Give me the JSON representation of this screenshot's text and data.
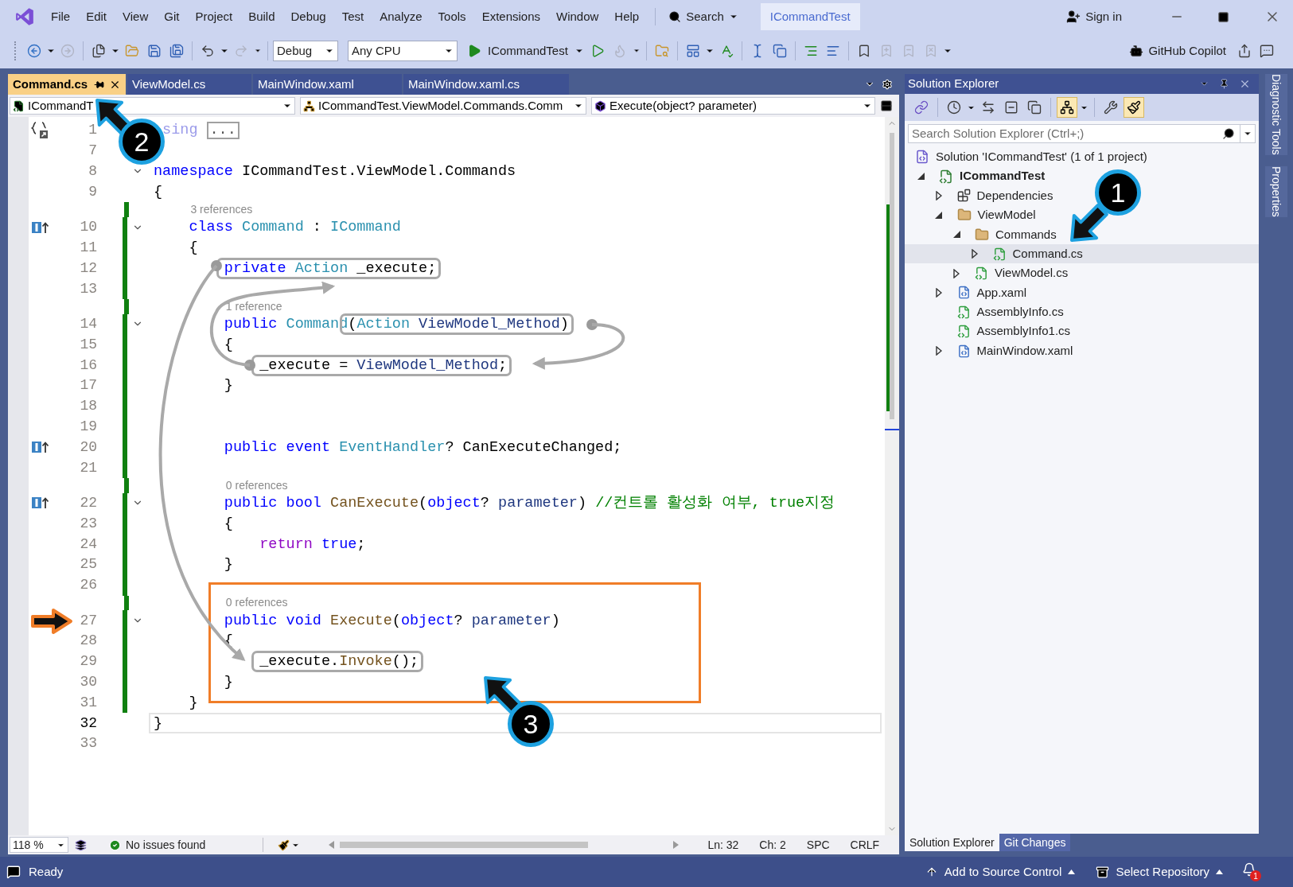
{
  "title_bar": {
    "menu": [
      "File",
      "Edit",
      "View",
      "Git",
      "Project",
      "Build",
      "Debug",
      "Test",
      "Analyze",
      "Tools",
      "Extensions",
      "Window",
      "Help"
    ],
    "search": "Search",
    "solution_name": "ICommandTest",
    "sign_in": "Sign in"
  },
  "toolbar": {
    "configuration": "Debug",
    "platform": "Any CPU",
    "startup_project": "ICommandTest",
    "copilot": "GitHub Copilot"
  },
  "document_tabs": [
    {
      "label": "Command.cs",
      "selected": true
    },
    {
      "label": "ViewModel.cs",
      "selected": false
    },
    {
      "label": "MainWindow.xaml",
      "selected": false
    },
    {
      "label": "MainWindow.xaml.cs",
      "selected": false
    }
  ],
  "navigation_bar": {
    "project": "ICommandT",
    "type": "ICommandTest.ViewModel.Commands.Comm",
    "member": "Execute(object? parameter)"
  },
  "editor": {
    "lines": [
      {
        "kind": "code",
        "n": "1",
        "margin": {
          "kind": "region"
        },
        "fold": false,
        "changed": false,
        "current": false,
        "tokens": [
          {
            "t": " sing",
            "kind": "faded"
          },
          {
            "t": "...",
            "kind": "collapsed"
          }
        ]
      },
      {
        "kind": "code",
        "n": "7",
        "fold": false,
        "changed": false,
        "current": false
      },
      {
        "kind": "code",
        "n": "8",
        "fold": true,
        "changed": false,
        "current": false,
        "tokens": [
          {
            "t": "namespace",
            "kind": "kw"
          },
          {
            "t": " ICommandTest.ViewModel.Commands",
            "kind": "plain"
          }
        ]
      },
      {
        "kind": "code",
        "n": "9",
        "fold": false,
        "changed": false,
        "current": false,
        "tokens": [
          {
            "t": "{",
            "kind": "plain"
          }
        ]
      },
      {
        "kind": "codelens",
        "text": "3 references",
        "changed": true
      },
      {
        "kind": "code",
        "n": "10",
        "margin": {
          "kind": "implements"
        },
        "fold": true,
        "changed": true,
        "current": false,
        "tokens": [
          {
            "t": "    class",
            "kind": "kw"
          },
          {
            "t": " Command",
            "kind": "type"
          },
          {
            "t": " : ",
            "kind": "plain"
          },
          {
            "t": "ICommand",
            "kind": "type"
          }
        ]
      },
      {
        "kind": "code",
        "n": "11",
        "fold": false,
        "changed": true,
        "current": false,
        "tokens": [
          {
            "t": "    {",
            "kind": "plain"
          }
        ]
      },
      {
        "kind": "code",
        "n": "12",
        "fold": false,
        "changed": true,
        "current": false,
        "tokens": [
          {
            "kind": "box",
            "parts": [
              {
                "t": "        private",
                "kind": "kw"
              },
              {
                "t": " Action",
                "kind": "type"
              },
              {
                "t": " _execute;",
                "kind": "plain"
              }
            ]
          }
        ]
      },
      {
        "kind": "code",
        "n": "13",
        "fold": false,
        "changed": true,
        "current": false
      },
      {
        "kind": "codelens",
        "text": "1 reference",
        "changed": true
      },
      {
        "kind": "code",
        "n": "14",
        "fold": true,
        "changed": true,
        "current": false,
        "tokens": [
          {
            "t": "        public",
            "kind": "kw"
          },
          {
            "t": " Command",
            "kind": "type"
          },
          {
            "kind": "box",
            "parts": [
              {
                "t": "(",
                "kind": "plain"
              },
              {
                "t": "Action",
                "kind": "type"
              },
              {
                "t": " ViewModel_Method",
                "kind": "param"
              },
              {
                "t": ")",
                "kind": "plain"
              }
            ]
          }
        ]
      },
      {
        "kind": "code",
        "n": "15",
        "fold": false,
        "changed": true,
        "current": false,
        "tokens": [
          {
            "t": "        {",
            "kind": "plain"
          }
        ]
      },
      {
        "kind": "code",
        "n": "16",
        "fold": false,
        "changed": true,
        "current": false,
        "tokens": [
          {
            "kind": "box",
            "parts": [
              {
                "t": "            _execute = ",
                "kind": "plain"
              },
              {
                "t": "ViewModel_Method",
                "kind": "param"
              },
              {
                "t": ";",
                "kind": "plain"
              }
            ]
          }
        ]
      },
      {
        "kind": "code",
        "n": "17",
        "fold": false,
        "changed": true,
        "current": false,
        "tokens": [
          {
            "t": "        }",
            "kind": "plain"
          }
        ]
      },
      {
        "kind": "code",
        "n": "18",
        "fold": false,
        "changed": true,
        "current": false
      },
      {
        "kind": "code",
        "n": "19",
        "fold": false,
        "changed": true,
        "current": false
      },
      {
        "kind": "code",
        "n": "20",
        "margin": {
          "kind": "implements"
        },
        "fold": false,
        "changed": true,
        "current": false,
        "tokens": [
          {
            "t": "        public",
            "kind": "kw"
          },
          {
            "t": " event",
            "kind": "kw"
          },
          {
            "t": " EventHandler",
            "kind": "type"
          },
          {
            "t": "? CanExecuteChanged;",
            "kind": "plain"
          }
        ]
      },
      {
        "kind": "code",
        "n": "21",
        "fold": false,
        "changed": true,
        "current": false
      },
      {
        "kind": "codelens",
        "text": "0 references",
        "changed": true
      },
      {
        "kind": "code",
        "n": "22",
        "margin": {
          "kind": "implements"
        },
        "fold": true,
        "changed": true,
        "current": false,
        "tokens": [
          {
            "t": "        public",
            "kind": "kw"
          },
          {
            "t": " bool",
            "kind": "kw"
          },
          {
            "t": " CanExecute",
            "kind": "method"
          },
          {
            "t": "(",
            "kind": "plain"
          },
          {
            "t": "object",
            "kind": "kw"
          },
          {
            "t": "? ",
            "kind": "plain"
          },
          {
            "t": "parameter",
            "kind": "param"
          },
          {
            "t": ") ",
            "kind": "plain"
          },
          {
            "t": "//컨트롤 활성화 여부, true지정",
            "kind": "comment"
          }
        ]
      },
      {
        "kind": "code",
        "n": "23",
        "fold": false,
        "changed": true,
        "current": false,
        "tokens": [
          {
            "t": "        {",
            "kind": "plain"
          }
        ]
      },
      {
        "kind": "code",
        "n": "24",
        "fold": false,
        "changed": true,
        "current": false,
        "tokens": [
          {
            "t": "            return",
            "kind": "ctrl"
          },
          {
            "t": " true",
            "kind": "kw"
          },
          {
            "t": ";",
            "kind": "plain"
          }
        ]
      },
      {
        "kind": "code",
        "n": "25",
        "fold": false,
        "changed": true,
        "current": false,
        "tokens": [
          {
            "t": "        }",
            "kind": "plain"
          }
        ]
      },
      {
        "kind": "code",
        "n": "26",
        "fold": false,
        "changed": true,
        "current": false
      },
      {
        "kind": "codelens",
        "text": "0 references",
        "changed": true
      },
      {
        "kind": "code",
        "n": "27",
        "fold": true,
        "changed": true,
        "current": false,
        "tokens": [
          {
            "t": "        public",
            "kind": "kw"
          },
          {
            "t": " void",
            "kind": "kw"
          },
          {
            "t": " Execute",
            "kind": "method"
          },
          {
            "t": "(",
            "kind": "plain"
          },
          {
            "t": "object",
            "kind": "kw"
          },
          {
            "t": "? ",
            "kind": "plain"
          },
          {
            "t": "parameter",
            "kind": "param"
          },
          {
            "t": ")",
            "kind": "plain"
          }
        ]
      },
      {
        "kind": "code",
        "n": "28",
        "fold": false,
        "changed": true,
        "current": false,
        "tokens": [
          {
            "t": "        {",
            "kind": "plain"
          }
        ]
      },
      {
        "kind": "code",
        "n": "29",
        "fold": false,
        "changed": true,
        "current": false,
        "tokens": [
          {
            "kind": "box",
            "parts": [
              {
                "t": "            _execute.",
                "kind": "plain"
              },
              {
                "t": "Invoke",
                "kind": "method"
              },
              {
                "t": "();",
                "kind": "plain"
              }
            ]
          }
        ]
      },
      {
        "kind": "code",
        "n": "30",
        "fold": false,
        "changed": true,
        "current": false,
        "tokens": [
          {
            "t": "        }",
            "kind": "plain"
          }
        ]
      },
      {
        "kind": "code",
        "n": "31",
        "fold": false,
        "changed": true,
        "current": false,
        "tokens": [
          {
            "t": "    }",
            "kind": "plain"
          }
        ]
      },
      {
        "kind": "code",
        "n": "32",
        "fold": false,
        "changed": false,
        "current": true,
        "tokens": [
          {
            "t": "}",
            "kind": "plain"
          }
        ]
      },
      {
        "kind": "code",
        "n": "33",
        "fold": false,
        "changed": false,
        "current": false
      }
    ]
  },
  "editor_status": {
    "zoom": "118 %",
    "issues": "No issues found",
    "line": "Ln: 32",
    "column": "Ch: 2",
    "whitespace": "SPC",
    "line_endings": "CRLF"
  },
  "solution_explorer": {
    "title": "Solution Explorer",
    "search": {
      "placeholder": "Search Solution Explorer (Ctrl+;)"
    },
    "tree": [
      {
        "label": "Solution 'ICommandTest' (1 of 1 project)",
        "kind": "solution",
        "selected": false,
        "children": [
          {
            "label": "ICommandTest",
            "kind": "project",
            "expanded": true,
            "selected": false,
            "children": [
              {
                "label": "Dependencies",
                "kind": "dependencies",
                "expanded": false,
                "selected": false
              },
              {
                "label": "ViewModel",
                "kind": "folder",
                "expanded": true,
                "selected": false,
                "children": [
                  {
                    "label": "Commands",
                    "kind": "folder",
                    "expanded": true,
                    "selected": false,
                    "children": [
                      {
                        "label": "Command.cs",
                        "kind": "csharp",
                        "expanded": false,
                        "selected": true
                      }
                    ]
                  },
                  {
                    "label": "ViewModel.cs",
                    "kind": "csharp",
                    "expanded": false,
                    "selected": false
                  }
                ]
              },
              {
                "label": "App.xaml",
                "kind": "xaml",
                "expanded": false,
                "selected": false
              },
              {
                "label": "AssemblyInfo.cs",
                "kind": "csharp",
                "selected": false
              },
              {
                "label": "AssemblyInfo1.cs",
                "kind": "csharp",
                "selected": false
              },
              {
                "label": "MainWindow.xaml",
                "kind": "xaml",
                "expanded": false,
                "selected": false
              }
            ]
          }
        ]
      }
    ],
    "bottom_tabs": [
      {
        "label": "Solution Explorer",
        "selected": true
      },
      {
        "label": "Git Changes",
        "selected": false
      }
    ]
  },
  "side_tabs": [
    "Diagnostic Tools",
    "Properties"
  ],
  "status_bar": {
    "status": "Ready",
    "source_control": "Add to Source Control",
    "repository": "Select Repository",
    "notifications": "1"
  },
  "annotations": {
    "callouts": [
      "1",
      "2",
      "3"
    ]
  }
}
